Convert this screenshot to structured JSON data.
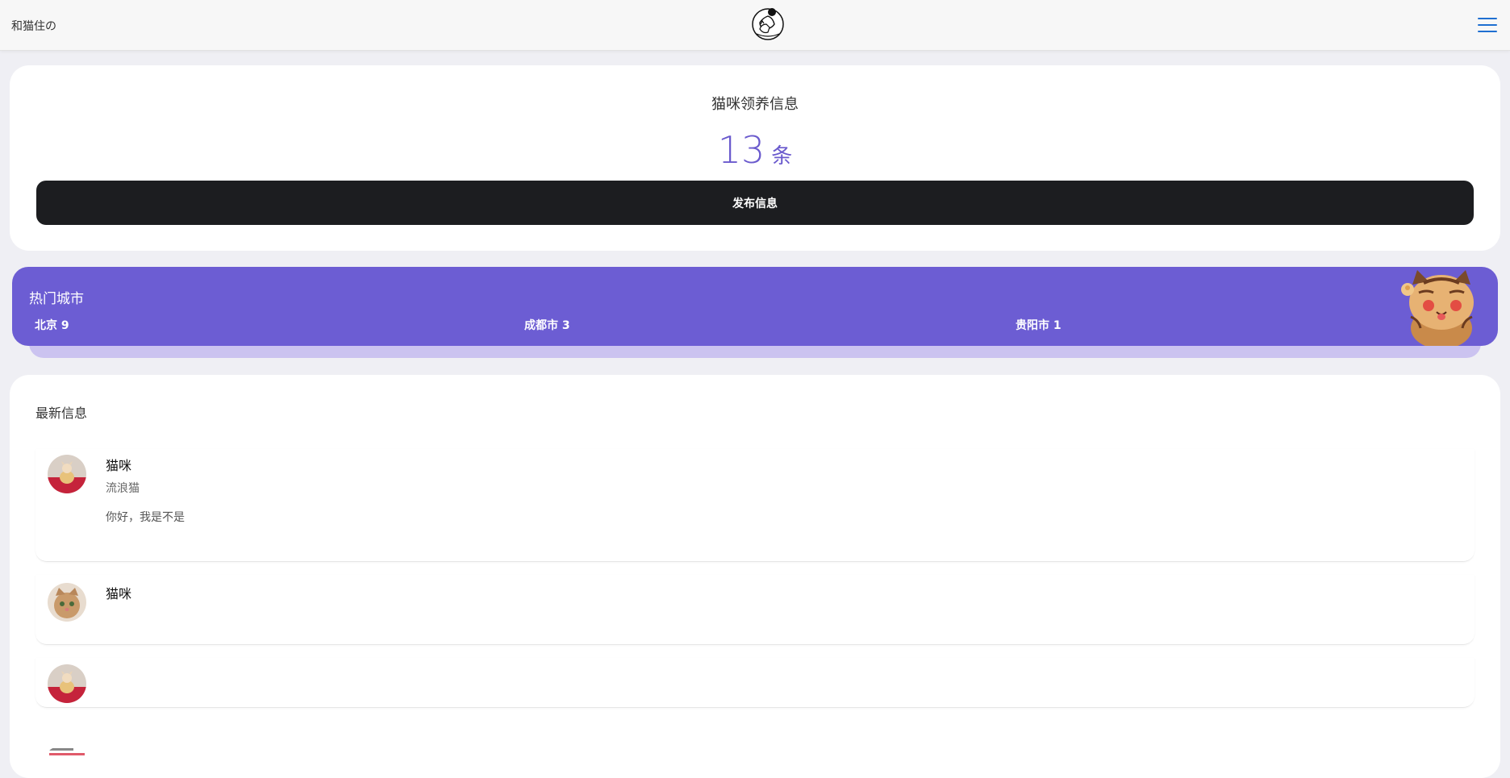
{
  "header": {
    "app_title": "和猫住の",
    "logo_icon": "cat-person-logo-icon",
    "menu_icon": "hamburger-menu-icon",
    "menu_color": "#1f6fd1"
  },
  "stats": {
    "title": "猫咪领养信息",
    "count": "13",
    "unit": "条",
    "accent": "#6a5acd",
    "publish_label": "发布信息"
  },
  "hot_cities": {
    "title": "热门城市",
    "cities": [
      {
        "label": "北京 9"
      },
      {
        "label": "成都市 3"
      },
      {
        "label": "贵阳市 1"
      }
    ],
    "illustration_icon": "cartoon-cat-illustration-icon",
    "banner_color": "#6c5dd3"
  },
  "latest": {
    "title": "最新信息",
    "items": [
      {
        "name": "猫咪",
        "tag": "流浪猫",
        "desc": "你好，我是不是"
      },
      {
        "name": "猫咪",
        "tag": "",
        "desc": ""
      },
      {
        "name": "",
        "tag": "",
        "desc": ""
      }
    ]
  }
}
